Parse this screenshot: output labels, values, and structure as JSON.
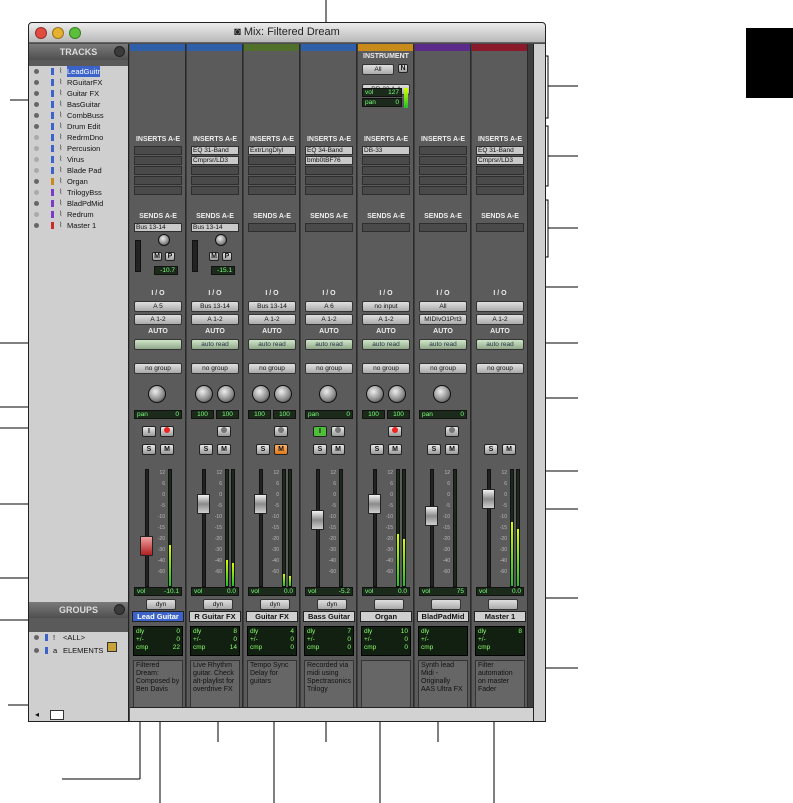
{
  "window": {
    "title": "Mix: Filtered Dream",
    "close_color": "#e24b3f",
    "minimize_color": "#e6b12f",
    "zoom_color": "#5bbf3a"
  },
  "tracks_panel": {
    "header": "TRACKS",
    "items": [
      {
        "name": "LeadGuitr",
        "color": "#3b63c9",
        "icon": "waveform-icon",
        "active": true
      },
      {
        "name": "RGuitarFX",
        "color": "#3b63c9",
        "icon": "waveform-icon",
        "active": true
      },
      {
        "name": "Guitar FX",
        "color": "#3b63c9",
        "icon": "aux-input-icon",
        "active": true
      },
      {
        "name": "BasGuitar",
        "color": "#3b63c9",
        "icon": "waveform-icon",
        "active": true
      },
      {
        "name": "CombBuss",
        "color": "#3b63c9",
        "icon": "waveform-icon",
        "active": true
      },
      {
        "name": "Drum Edit",
        "color": "#3b63c9",
        "icon": "waveform-icon",
        "active": true
      },
      {
        "name": "RedrmDno",
        "color": "#3b63c9",
        "icon": "waveform-icon",
        "active": false
      },
      {
        "name": "Percusion",
        "color": "#3b63c9",
        "icon": "waveform-icon",
        "active": false
      },
      {
        "name": "Virus",
        "color": "#3b63c9",
        "icon": "waveform-icon",
        "active": false
      },
      {
        "name": "Blade Pad",
        "color": "#3b63c9",
        "icon": "waveform-icon",
        "active": false
      },
      {
        "name": "Organ",
        "color": "#c88a1a",
        "icon": "instrument-icon",
        "active": true
      },
      {
        "name": "TrilogyBss",
        "color": "#7a3bc9",
        "icon": "midi-icon",
        "active": false
      },
      {
        "name": "BladPdMid",
        "color": "#7a3bc9",
        "icon": "midi-icon",
        "active": true
      },
      {
        "name": "Redrum",
        "color": "#7a3bc9",
        "icon": "midi-icon",
        "active": false
      },
      {
        "name": "Master 1",
        "color": "#c92b2b",
        "icon": "master-icon",
        "active": true
      }
    ]
  },
  "groups_panel": {
    "header": "GROUPS",
    "items": [
      {
        "id": "!",
        "name": "<ALL>"
      },
      {
        "id": "a",
        "name": "ELEMENTS"
      }
    ]
  },
  "labels": {
    "instrument": "INSTRUMENT",
    "inserts": "INSERTS A-E",
    "sends": "SENDS A-E",
    "io": "I / O",
    "auto": "AUTO",
    "dyn": "dyn",
    "vol": "vol",
    "pan": "pan",
    "dly": "dly",
    "plusminus": "+/-",
    "cmp": "cmp"
  },
  "instrument": {
    "input": "All",
    "n_btn": "N",
    "device": "DB-33 1-1",
    "vol": "127",
    "pan": "0"
  },
  "strips": [
    {
      "name": "Lead Guitar",
      "color": "#2f5fa8",
      "name_active": true,
      "inserts": [],
      "sends": [
        "Bus 13-14"
      ],
      "send_vol": "-10.7",
      "io_in": "A 5",
      "io_out": "A 1-2",
      "auto": "",
      "group": "no group",
      "pan_l": "0",
      "pan_r": "",
      "vol": "-10.1",
      "dly": "0",
      "pm": "0",
      "cmp": "22",
      "comment": "Filtered Dream: Composed by Ben Davis",
      "meter": 0.35,
      "fader": 0.32,
      "stereo": false
    },
    {
      "name": "R Guitar FX",
      "color": "#2f5fa8",
      "name_active": false,
      "inserts": [
        "EQ 31-Band",
        "Cmprsr/LD3"
      ],
      "sends": [
        "Bus 13-14"
      ],
      "send_vol": "-15.1",
      "io_in": "Bus 13-14",
      "io_out": "A 1-2",
      "auto": "auto read",
      "group": "no group",
      "pan_l": "100",
      "pan_r": "100",
      "vol": "0.0",
      "dly": "8",
      "pm": "0",
      "cmp": "14",
      "comment": "Live Rhythm guitar. Check alt-playlist for overdrive FX",
      "meter": 0.22,
      "fader": 0.75,
      "stereo": true
    },
    {
      "name": "Guitar FX",
      "color": "#4f6f2a",
      "name_active": false,
      "inserts": [
        "ExtrLngDlyl"
      ],
      "sends": [],
      "send_vol": "",
      "io_in": "Bus 13-14",
      "io_out": "A 1-2",
      "auto": "auto read",
      "group": "no group",
      "pan_l": "100",
      "pan_r": "100",
      "vol": "0.0",
      "dly": "4",
      "pm": "0",
      "cmp": "0",
      "comment": "Tempo Sync Delay for guitars",
      "meter": 0.1,
      "fader": 0.75,
      "stereo": true
    },
    {
      "name": "Bass Guitar",
      "color": "#2f5fa8",
      "name_active": false,
      "inserts": [
        "EQ 34-Band",
        "bmb0tBF76"
      ],
      "sends": [],
      "send_vol": "",
      "io_in": "A 6",
      "io_out": "A 1-2",
      "auto": "auto read",
      "group": "no group",
      "pan_l": "0",
      "pan_r": "",
      "vol": "-5.2",
      "dly": "7",
      "pm": "0",
      "cmp": "0",
      "comment": "Recorded via midi using Spectrasonics Trilogy",
      "meter": 0.0,
      "fader": 0.58,
      "stereo": false
    },
    {
      "name": "Organ",
      "color": "#c88a1a",
      "name_active": false,
      "inserts": [
        "DB-33"
      ],
      "sends": [],
      "send_vol": "",
      "io_in": "no input",
      "io_out": "A 1-2",
      "auto": "auto read",
      "group": "no group",
      "pan_l": "100",
      "pan_r": "100",
      "vol": "0.0",
      "dly": "10",
      "pm": "0",
      "cmp": "0",
      "comment": "",
      "meter": 0.45,
      "fader": 0.75,
      "stereo": true
    },
    {
      "name": "BladPadMid",
      "color": "#5b2a8a",
      "name_active": false,
      "inserts": [],
      "sends": [],
      "send_vol": "",
      "io_in": "All",
      "io_out": "MIDIvO1Prt3",
      "auto": "auto read",
      "group": "no group",
      "pan_l": "0",
      "pan_r": "",
      "vol": "75",
      "dly": "",
      "pm": "",
      "cmp": "",
      "comment": "Synth lead Midi - Originally AAS Ultra FX",
      "meter": 0.0,
      "fader": 0.62,
      "stereo": false
    },
    {
      "name": "Master 1",
      "color": "#8a1a2a",
      "name_active": false,
      "inserts": [
        "EQ 31-Band",
        "Cmprsr/LD3"
      ],
      "sends": [],
      "send_vol": "",
      "io_in": "",
      "io_out": "A 1-2",
      "auto": "auto read",
      "group": "no group",
      "pan_l": "",
      "pan_r": "",
      "vol": "0.0",
      "dly": "8",
      "pm": "",
      "cmp": "",
      "comment": "Filter automation on master Fader",
      "meter": 0.55,
      "fader": 0.8,
      "stereo": true
    }
  ],
  "scale_ticks": [
    "12",
    "6",
    "0",
    "-5",
    "-10",
    "-15",
    "-20",
    "-30",
    "-40",
    "-60"
  ]
}
